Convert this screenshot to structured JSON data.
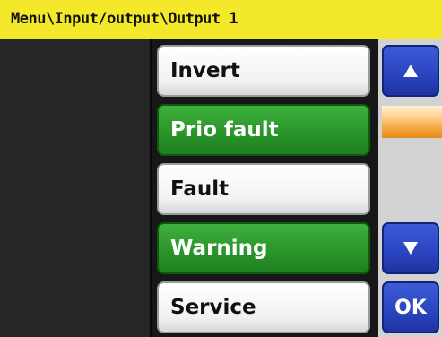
{
  "titlebar": {
    "path": "Menu\\Input/output\\Output 1"
  },
  "list": {
    "items": [
      {
        "label": "Invert",
        "style": "white"
      },
      {
        "label": "Prio fault",
        "style": "green"
      },
      {
        "label": "Fault",
        "style": "white"
      },
      {
        "label": "Warning",
        "style": "green"
      },
      {
        "label": "Service",
        "style": "white"
      }
    ]
  },
  "scroll": {
    "up_icon": "triangle-up-icon",
    "down_icon": "triangle-down-icon",
    "ok_label": "OK",
    "position": 0.0
  },
  "colors": {
    "titlebar": "#f3e82a",
    "selected_green": "#2d9a2d",
    "button_blue": "#2a44c0",
    "scroll_thumb": "#f5a540"
  }
}
